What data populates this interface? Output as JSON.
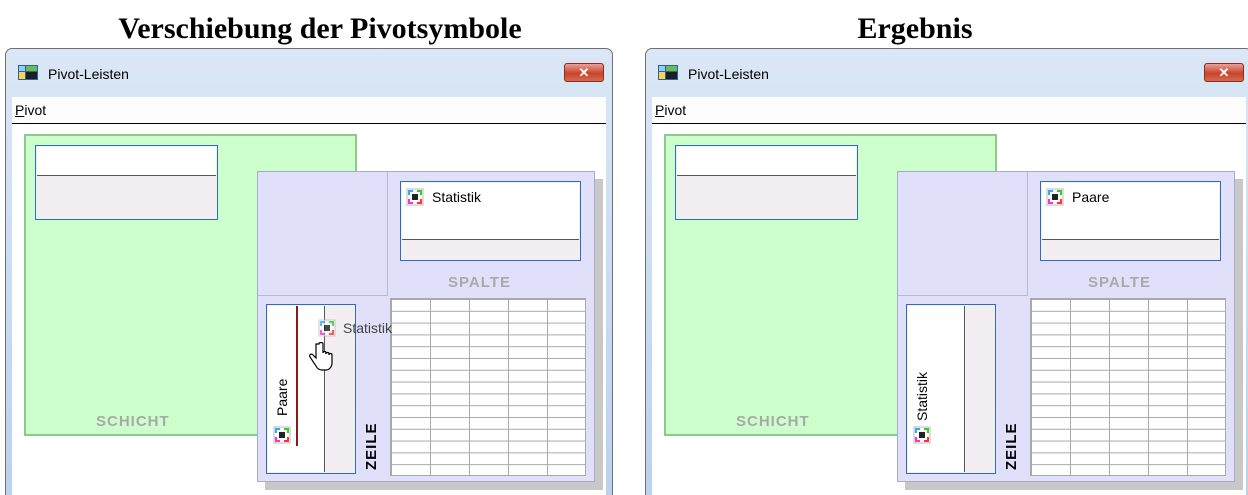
{
  "headings": {
    "left": "Verschiebung der Pivotsymbole",
    "right": "Ergebnis"
  },
  "left_window": {
    "title": "Pivot-Leisten",
    "close_glyph": "✕",
    "menu": {
      "pivot_first": "P",
      "pivot_rest": "ivot"
    },
    "layer_label": "SCHICHT",
    "column_label": "SPALTE",
    "row_label": "ZEILE",
    "column_items": [
      "Statistik"
    ],
    "row_items": [
      "Paare"
    ],
    "dragging_item": "Statistik"
  },
  "right_window": {
    "title": "Pivot-Leisten",
    "close_glyph": "✕",
    "menu": {
      "pivot_first": "P",
      "pivot_rest": "ivot"
    },
    "layer_label": "SCHICHT",
    "column_label": "SPALTE",
    "row_label": "ZEILE",
    "column_items": [
      "Paare"
    ],
    "row_items": [
      "Statistik"
    ]
  },
  "icons": {
    "app": "pivot-table-icon",
    "pivot_item": "pivot-icon",
    "cursor": "hand-cursor-icon",
    "close": "close-icon"
  },
  "colors": {
    "layer_fill": "#ccffcc",
    "table_fill": "#e0e0fa",
    "list_border": "#2a6fb8",
    "insert_marker": "#8b1a1a",
    "close_button": "#c8442c"
  }
}
